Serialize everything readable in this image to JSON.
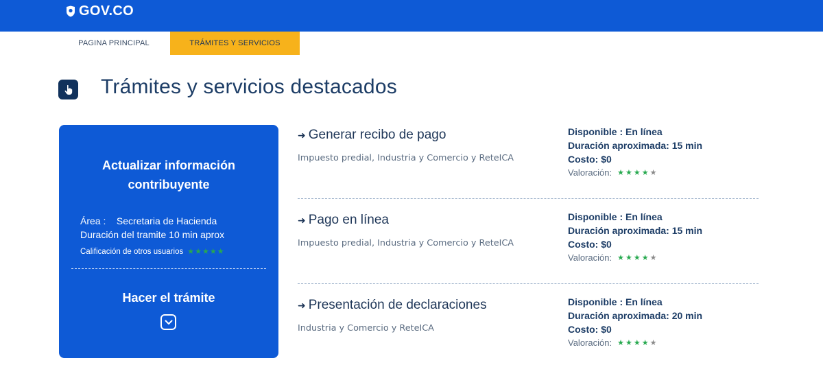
{
  "header": {
    "logo_text": "GOV.CO",
    "bar_color": "#0e5ad6"
  },
  "nav": {
    "tabs": [
      {
        "label": "PAGINA PRINCIPAL",
        "active": false
      },
      {
        "label": "TRÁMITES Y SERVICIOS",
        "active": true
      }
    ],
    "active_color": "#f7b21b"
  },
  "section": {
    "title": "Trámites y servicios destacados",
    "icon": "hand-pointer-icon"
  },
  "featured": {
    "title": "Actualizar información contribuyente",
    "area_label": "Área :",
    "area_value": "Secretaria de Hacienda",
    "duration": "Duración del tramite 10 min aprox",
    "rating_label": "Calificación de otros usuarios",
    "cta": "Hacer el trámite",
    "cta_icon": "chevron-down-icon",
    "rating_stars": 5
  },
  "services": [
    {
      "title": "Generar recibo de pago",
      "description": "Impuesto predial, Industria y Comercio y ReteICA",
      "available": "Disponible : En línea",
      "duration": "Duración aproximada: 15 min",
      "cost": "Costo: $0",
      "rating_label": "Valoración:",
      "rating": 4,
      "rating_max": 5
    },
    {
      "title": "Pago en línea",
      "description": "Impuesto predial, Industria y Comercio y ReteICA",
      "available": "Disponible : En línea",
      "duration": "Duración aproximada: 15 min",
      "cost": "Costo: $0",
      "rating_label": "Valoración:",
      "rating": 4,
      "rating_max": 5
    },
    {
      "title": "Presentación de declaraciones",
      "description": "Industria y Comercio y ReteICA",
      "available": "Disponible : En línea",
      "duration": "Duración aproximada: 20 min",
      "cost": "Costo: $0",
      "rating_label": "Valoración:",
      "rating": 4,
      "rating_max": 5
    }
  ]
}
